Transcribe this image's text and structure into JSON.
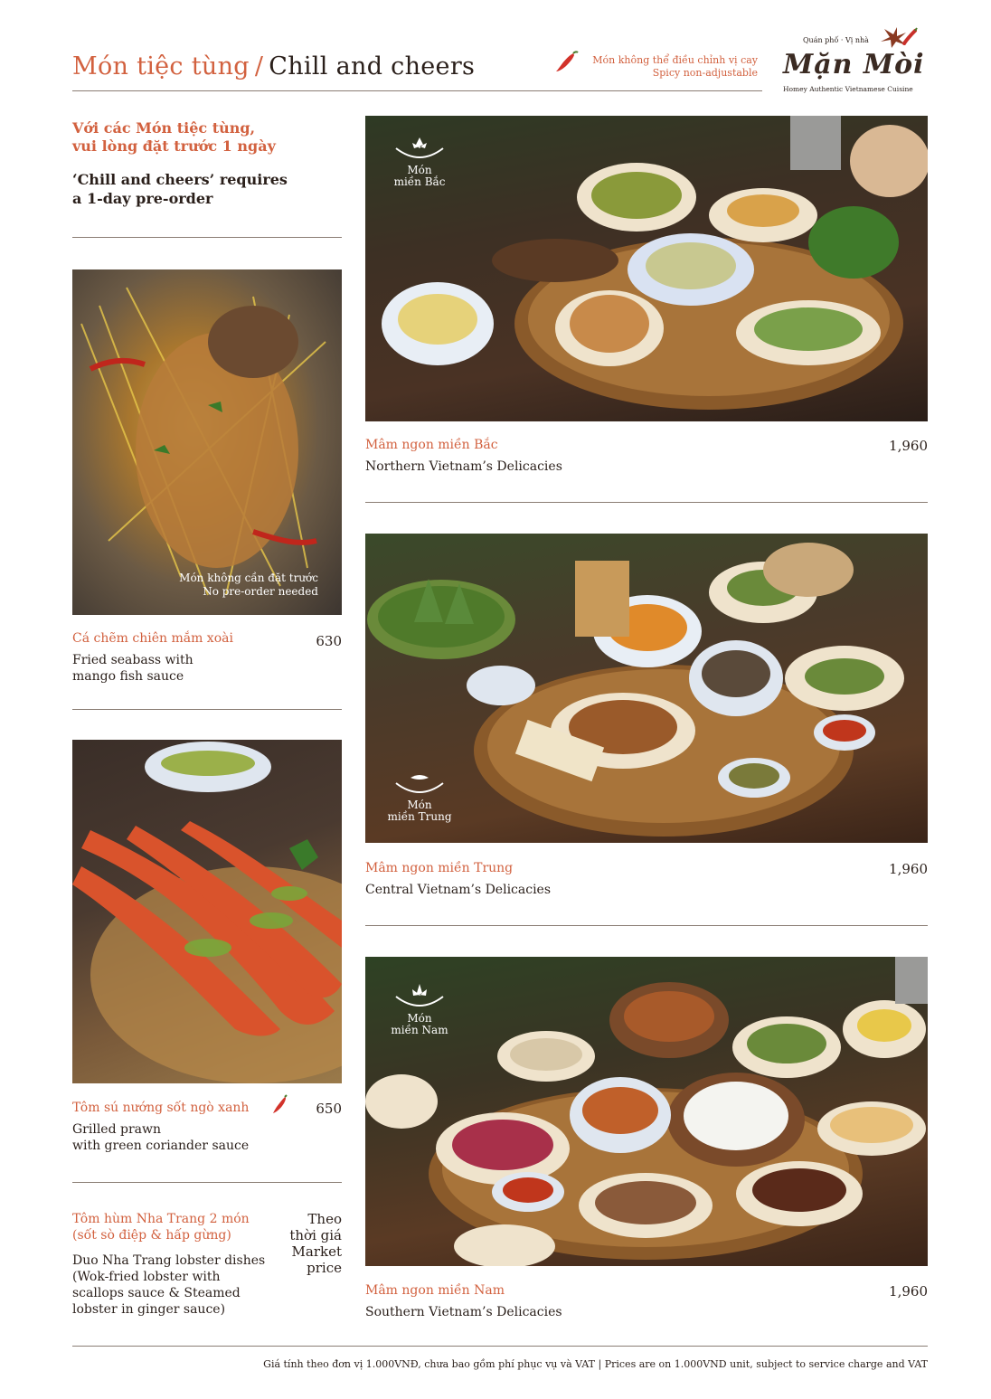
{
  "header": {
    "title_vi": "Món tiệc tùng",
    "title_sep": "/",
    "title_en": "Chill and cheers",
    "spicy_note_vi": "Món không thể điều chỉnh vị cay",
    "spicy_note_en": "Spicy non-adjustable"
  },
  "logo": {
    "small_top": "Quán phố · Vị nhà",
    "brand": "Mặn Mòi",
    "tagline": "Homey Authentic Vietnamese Cuisine"
  },
  "preorder": {
    "vi_line1": "Với các Món tiệc tùng,",
    "vi_line2": "vui lòng đặt trước 1 ngày",
    "en_line1": "‘Chill and cheers’ requires",
    "en_line2": "a 1-day pre-order"
  },
  "left_dishes": [
    {
      "photo_note_vi": "Món không cần đặt trước",
      "photo_note_en": "No pre-order needed",
      "name_vi": "Cá chẽm chiên mắm xoài",
      "name_en_1": "Fried seabass with",
      "name_en_2": "mango fish sauce",
      "price": "630"
    },
    {
      "name_vi": "Tôm sú nướng sốt ngò xanh",
      "spicy": true,
      "name_en_1": "Grilled prawn",
      "name_en_2": "with green coriander sauce",
      "price": "650"
    },
    {
      "name_vi_1": "Tôm hùm Nha Trang 2 món",
      "name_vi_2": "(sốt sò điệp & hấp gừng)",
      "name_en_1": "Duo Nha Trang lobster dishes",
      "name_en_2": "(Wok-fried lobster with",
      "name_en_3": "scallops sauce & Steamed",
      "name_en_4": "lobster in ginger sauce)",
      "price_1": "Theo",
      "price_2": "thời giá",
      "price_3": "Market",
      "price_4": "price"
    }
  ],
  "right_dishes": [
    {
      "badge_1": "Món",
      "badge_2": "miền Bắc",
      "name_vi": "Mâm ngon miền Bắc",
      "name_en": "Northern Vietnam’s Delicacies",
      "price": "1,960"
    },
    {
      "badge_1": "Món",
      "badge_2": "miền Trung",
      "name_vi": "Mâm ngon miền Trung",
      "name_en": "Central Vietnam’s Delicacies",
      "price": "1,960"
    },
    {
      "badge_1": "Món",
      "badge_2": "miền Nam",
      "name_vi": "Mâm ngon miền Nam",
      "name_en": "Southern Vietnam’s Delicacies",
      "price": "1,960"
    }
  ],
  "footer": {
    "note": "Giá tính theo đơn vị 1.000VNĐ, chưa bao gồm phí phục vụ và VAT  |  Prices are on 1.000VND unit, subject to service charge and VAT"
  },
  "colors": {
    "accent": "#d2613f",
    "text": "#2a1f1a",
    "rule": "#8a7d74"
  },
  "icons": [
    "chili-icon",
    "star-anise-icon",
    "bowl-icon"
  ]
}
